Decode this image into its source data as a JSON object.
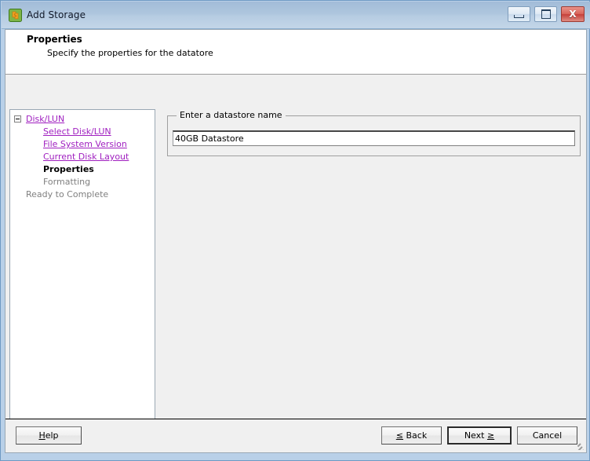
{
  "window": {
    "title": "Add Storage",
    "icon": "add-storage-icon",
    "controls": {
      "minimize_label": "Minimize",
      "maximize_label": "Maximize",
      "close_label": "X"
    }
  },
  "header": {
    "title": "Properties",
    "subtitle": "Specify the properties for the datatore"
  },
  "tree": {
    "items": [
      {
        "label": "Disk/LUN",
        "state": "link",
        "indent": 0,
        "expander": "collapse-minus-icon"
      },
      {
        "label": "Select Disk/LUN",
        "state": "link",
        "indent": 1
      },
      {
        "label": "File System Version",
        "state": "link",
        "indent": 1
      },
      {
        "label": "Current Disk Layout",
        "state": "link",
        "indent": 1
      },
      {
        "label": "Properties",
        "state": "current",
        "indent": 1
      },
      {
        "label": "Formatting",
        "state": "dim",
        "indent": 1
      },
      {
        "label": "Ready to Complete",
        "state": "dim",
        "indent": 0
      }
    ]
  },
  "content": {
    "group_legend": "Enter a datastore name",
    "datastore_name": "40GB Datastore",
    "datastore_name_placeholder": "Enter a datastore name"
  },
  "buttons": {
    "help": {
      "pre": "",
      "mnemonic": "H",
      "post": "elp"
    },
    "back": {
      "pre": "",
      "mnemonic": "≤",
      "post": " Back"
    },
    "next": {
      "pre": "Next ",
      "mnemonic": "≥",
      "post": ""
    },
    "cancel": {
      "pre": "Cancel",
      "mnemonic": "",
      "post": ""
    }
  },
  "colors": {
    "link": "#a020c0",
    "titlebar_top": "#a2bcd8",
    "close_button": "#c5403a",
    "window_border": "#b9d0e8"
  }
}
